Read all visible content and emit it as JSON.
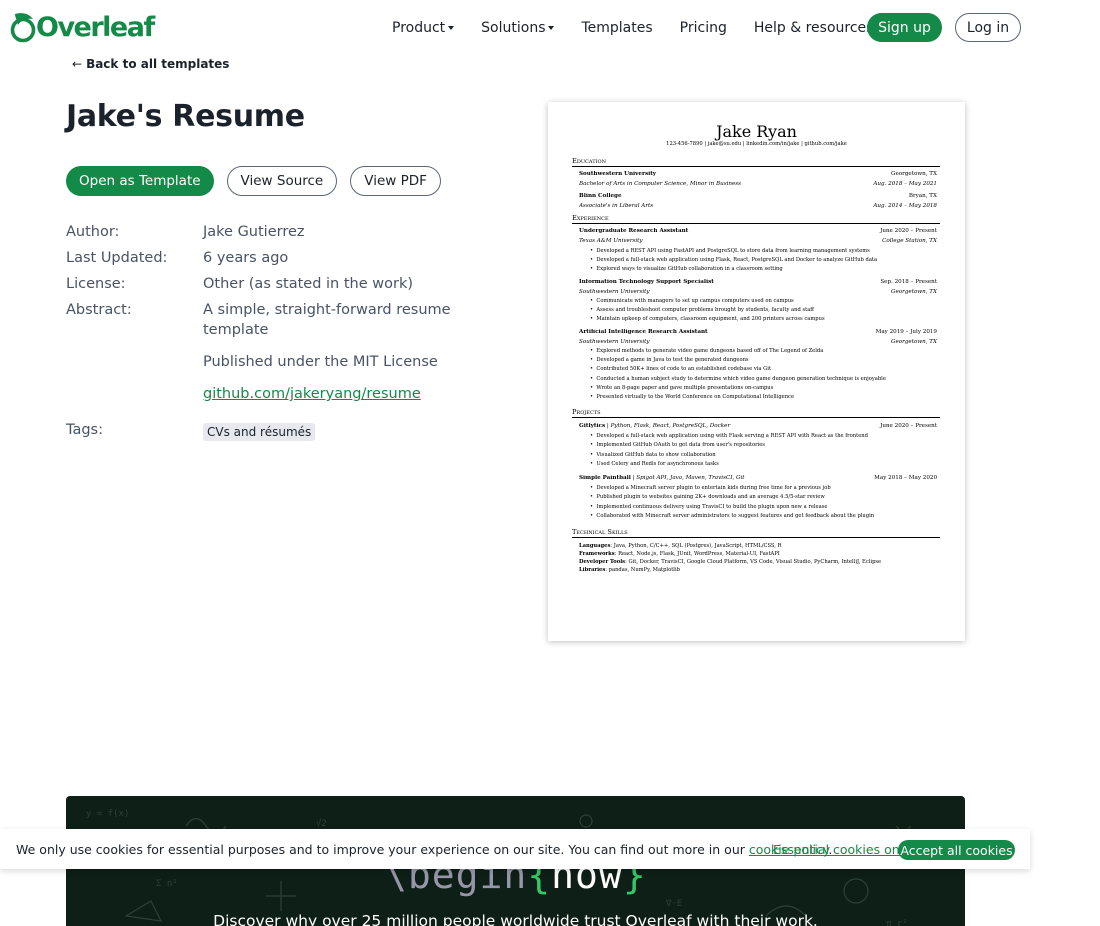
{
  "brand": {
    "name": "Overleaf",
    "color": "#138a47"
  },
  "nav": {
    "items": [
      {
        "label": "Product",
        "dropdown": true
      },
      {
        "label": "Solutions",
        "dropdown": true
      },
      {
        "label": "Templates",
        "dropdown": false
      },
      {
        "label": "Pricing",
        "dropdown": false
      },
      {
        "label": "Help & resources",
        "dropdown": true
      }
    ],
    "signup": "Sign up",
    "login": "Log in"
  },
  "back_link": "Back to all templates",
  "template": {
    "title": "Jake's Resume",
    "actions": {
      "open": "Open as Template",
      "source": "View Source",
      "pdf": "View PDF"
    },
    "meta": {
      "author_label": "Author:",
      "author": "Jake Gutierrez",
      "updated_label": "Last Updated:",
      "updated": "6 years ago",
      "license_label": "License:",
      "license": "Other (as stated in the work)",
      "abstract_label": "Abstract:",
      "abstract_1": "A simple, straight-forward resume template",
      "abstract_2": "Published under the MIT License",
      "abstract_link": "github.com/jakeryang/resume",
      "tags_label": "Tags:",
      "tag": "CVs and résumés"
    }
  },
  "preview": {
    "name": "Jake Ryan",
    "contact": "123-456-7890 | jake@su.edu | linkedin.com/in/jake | github.com/jake",
    "sections": {
      "education": "Education",
      "experience": "Experience",
      "projects": "Projects",
      "skills": "Technical Skills"
    },
    "edu": [
      {
        "name": "Southwestern University",
        "loc": "Georgetown, TX",
        "degree": "Bachelor of Arts in Computer Science, Minor in Business",
        "date": "Aug. 2018 – May 2021"
      },
      {
        "name": "Blinn College",
        "loc": "Bryan, TX",
        "degree": "Associate's in Liberal Arts",
        "date": "Aug. 2014 – May 2018"
      }
    ],
    "exp": [
      {
        "role": "Undergraduate Research Assistant",
        "date": "June 2020 – Present",
        "org": "Texas A&M University",
        "loc": "College Station, TX",
        "bullets": [
          "Developed a REST API using FastAPI and PostgreSQL to store data from learning management systems",
          "Developed a full-stack web application using Flask, React, PostgreSQL and Docker to analyze GitHub data",
          "Explored ways to visualize GitHub collaboration in a classroom setting"
        ]
      },
      {
        "role": "Information Technology Support Specialist",
        "date": "Sep. 2018 – Present",
        "org": "Southwestern University",
        "loc": "Georgetown, TX",
        "bullets": [
          "Communicate with managers to set up campus computers used on campus",
          "Assess and troubleshoot computer problems brought by students, faculty and staff",
          "Maintain upkeep of computers, classroom equipment, and 200 printers across campus"
        ]
      },
      {
        "role": "Artificial Intelligence Research Assistant",
        "date": "May 2019 – July 2019",
        "org": "Southwestern University",
        "loc": "Georgetown, TX",
        "bullets": [
          "Explored methods to generate video game dungeons based off of The Legend of Zelda",
          "Developed a game in Java to test the generated dungeons",
          "Contributed 50K+ lines of code to an established codebase via Git",
          "Conducted a human subject study to determine which video game dungeon generation technique is enjoyable",
          "Wrote an 8-page paper and gave multiple presentations on-campus",
          "Presented virtually to the World Conference on Computational Intelligence"
        ]
      }
    ],
    "proj": [
      {
        "title": "Gitlytics",
        "stack": "Python, Flask, React, PostgreSQL, Docker",
        "date": "June 2020 – Present",
        "bullets": [
          "Developed a full-stack web application using with Flask serving a REST API with React as the frontend",
          "Implemented GitHub OAuth to get data from user's repositories",
          "Visualized GitHub data to show collaboration",
          "Used Celery and Redis for asynchronous tasks"
        ]
      },
      {
        "title": "Simple Paintball",
        "stack": "Spigot API, Java, Maven, TravisCI, Git",
        "date": "May 2018 – May 2020",
        "bullets": [
          "Developed a Minecraft server plugin to entertain kids during free time for a previous job",
          "Published plugin to websites gaining 2K+ downloads and an average 4.5/5-star review",
          "Implemented continuous delivery using TravisCI to build the plugin upon new a release",
          "Collaborated with Minecraft server administrators to suggest features and get feedback about the plugin"
        ]
      }
    ],
    "skills": [
      {
        "k": "Languages",
        "v": "Java, Python, C/C++, SQL (Postgres), JavaScript, HTML/CSS, R"
      },
      {
        "k": "Frameworks",
        "v": "React, Node.js, Flask, JUnit, WordPress, Material-UI, FastAPI"
      },
      {
        "k": "Developer Tools",
        "v": "Git, Docker, TravisCI, Google Cloud Platform, VS Code, Visual Studio, PyCharm, IntelliJ, Eclipse"
      },
      {
        "k": "Libraries",
        "v": "pandas, NumPy, Matplotlib"
      }
    ]
  },
  "banner": {
    "begin": "\\begin",
    "open_brace": "{",
    "now": "now",
    "close_brace": "}",
    "text": "Discover why over 25 million people worldwide trust Overleaf with their work."
  },
  "cookie": {
    "text": "We only use cookies for essential purposes and to improve your experience on our site. You can find out more in our ",
    "policy_link": "cookie policy",
    "period": ".",
    "essential": "Essential cookies only",
    "accept": "Accept all cookies"
  }
}
